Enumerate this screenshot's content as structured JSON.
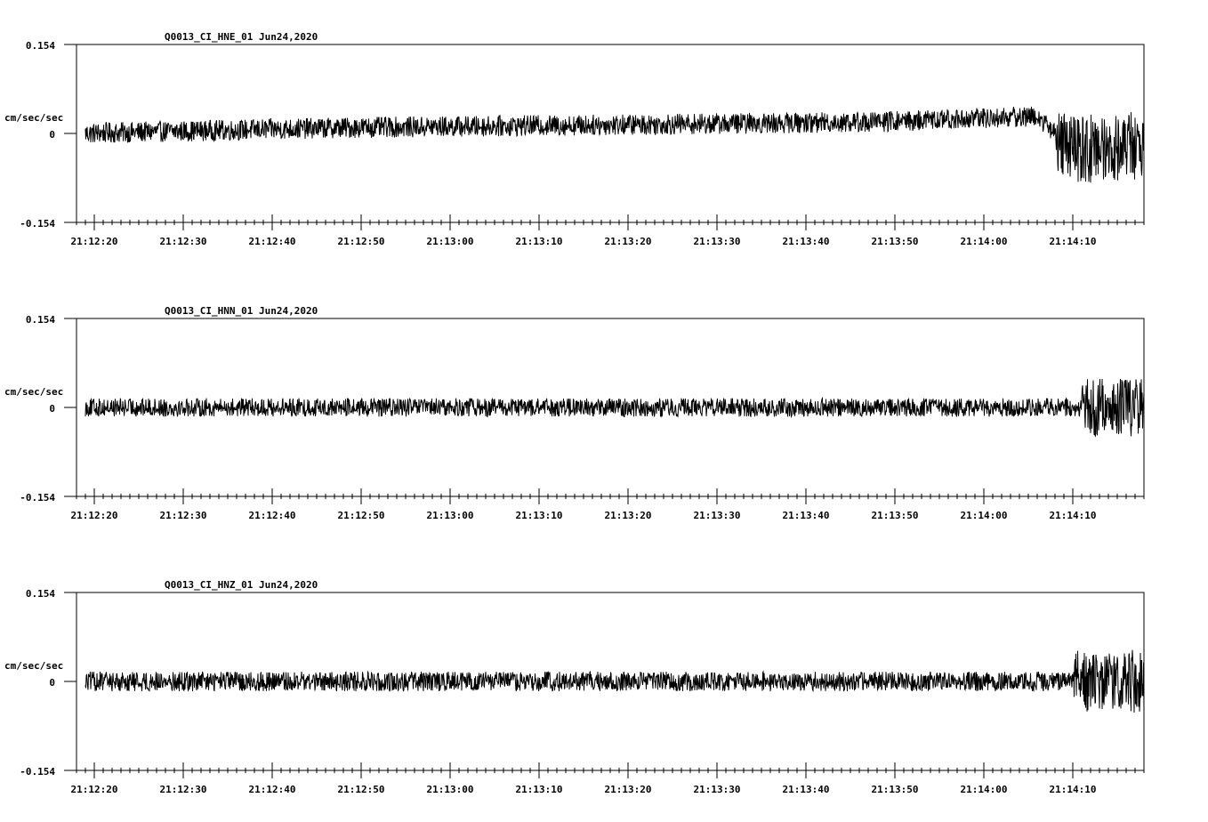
{
  "chart_data": [
    {
      "type": "line",
      "title": "Q0013_CI_HNE_01  Jun24,2020",
      "ylabel": "cm/sec/sec",
      "ylim": [
        -0.154,
        0.154
      ],
      "y_tick_labels": [
        "0.154",
        "0",
        "-0.154"
      ],
      "x_tick_labels": [
        "21:12:20",
        "21:12:30",
        "21:12:40",
        "21:12:50",
        "21:13:00",
        "21:13:10",
        "21:13:20",
        "21:13:30",
        "21:13:40",
        "21:13:50",
        "21:14:00",
        "21:14:10"
      ],
      "x_start_seconds": 18,
      "x_range_seconds": [
        0,
        120
      ],
      "noise_amplitude": 0.018,
      "drift": [
        [
          0,
          0.0
        ],
        [
          30,
          0.01
        ],
        [
          60,
          0.015
        ],
        [
          90,
          0.02
        ],
        [
          108,
          0.03
        ],
        [
          112,
          -0.03
        ],
        [
          118,
          -0.02
        ]
      ],
      "burst_start": 110,
      "burst_amplitude": 0.06
    },
    {
      "type": "line",
      "title": "Q0013_CI_HNN_01  Jun24,2020",
      "ylabel": "cm/sec/sec",
      "ylim": [
        -0.154,
        0.154
      ],
      "y_tick_labels": [
        "0.154",
        "0",
        "-0.154"
      ],
      "x_tick_labels": [
        "21:12:20",
        "21:12:30",
        "21:12:40",
        "21:12:50",
        "21:13:00",
        "21:13:10",
        "21:13:20",
        "21:13:30",
        "21:13:40",
        "21:13:50",
        "21:14:00",
        "21:14:10"
      ],
      "x_start_seconds": 18,
      "x_range_seconds": [
        0,
        120
      ],
      "noise_amplitude": 0.016,
      "drift": [
        [
          0,
          0.0
        ],
        [
          120,
          0.0
        ]
      ],
      "burst_start": 113,
      "burst_amplitude": 0.05
    },
    {
      "type": "line",
      "title": "Q0013_CI_HNZ_01  Jun24,2020",
      "ylabel": "cm/sec/sec",
      "ylim": [
        -0.154,
        0.154
      ],
      "y_tick_labels": [
        "0.154",
        "0",
        "-0.154"
      ],
      "x_tick_labels": [
        "21:12:20",
        "21:12:30",
        "21:12:40",
        "21:12:50",
        "21:13:00",
        "21:13:10",
        "21:13:20",
        "21:13:30",
        "21:13:40",
        "21:13:50",
        "21:14:00",
        "21:14:10"
      ],
      "x_start_seconds": 18,
      "x_range_seconds": [
        0,
        120
      ],
      "noise_amplitude": 0.017,
      "drift": [
        [
          0,
          0.0
        ],
        [
          120,
          0.0
        ]
      ],
      "burst_start": 112,
      "burst_amplitude": 0.055
    }
  ]
}
